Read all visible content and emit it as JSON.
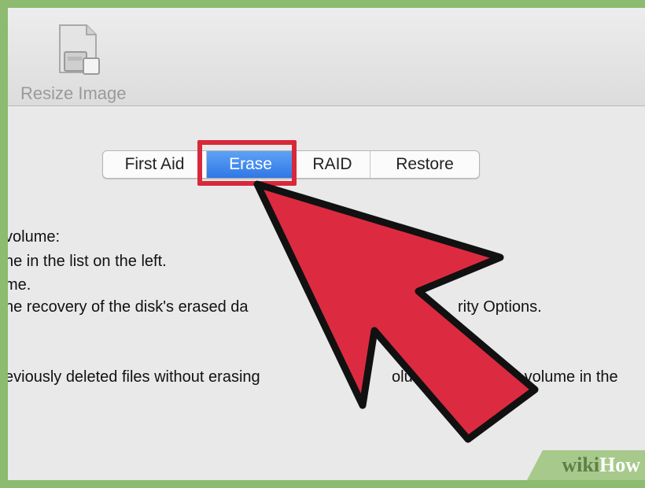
{
  "toolbar": {
    "resize_image_label": "Resize Image",
    "resize_image_icon": "document-resize-icon"
  },
  "tabs": [
    {
      "label": "First Aid"
    },
    {
      "label": "Erase",
      "selected": true
    },
    {
      "label": "RAID"
    },
    {
      "label": "Restore"
    }
  ],
  "instructions": {
    "line1": "volume:",
    "line2": "ne in the list on the left.",
    "line3": "me.",
    "line4": "ne recovery of the disk's erased da",
    "line4_tail": "rity Options.",
    "line5": "eviously deleted files without erasing",
    "line5_mid": "olume,",
    "line5_tail": "a volume in the"
  },
  "annotation": {
    "highlight_color": "#d8283a",
    "arrow_color": "#dc2b40",
    "arrow_icon": "pointer-arrow-icon"
  },
  "watermark": {
    "part1": "wiki",
    "part2": "How",
    "bg_color": "#a7c98b"
  }
}
